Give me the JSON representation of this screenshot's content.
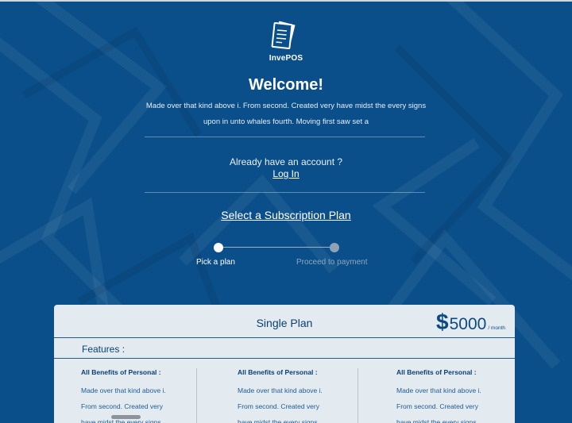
{
  "brand": {
    "name": "InvePOS"
  },
  "welcome": {
    "title": "Welcome!",
    "text": "Made over that kind above i. From second. Created very have midst the every signs upon in unto whales fourth. Moving first saw set a"
  },
  "account": {
    "prompt": "Already have an account ?",
    "login_label": "Log In"
  },
  "subscription": {
    "heading": "Select a Subscription Plan",
    "steps": [
      {
        "label": "Pick a plan",
        "active": true
      },
      {
        "label": "Proceed to payment",
        "active": false
      }
    ]
  },
  "plan": {
    "name": "Single Plan",
    "currency_symbol": "$",
    "price": "5000",
    "period": "/ month",
    "features_title": "Features :",
    "columns": [
      {
        "title": "All Benefits of Personal :",
        "text": "Made over that kind above i. From second. Created very have midst the every signs"
      },
      {
        "title": "All Benefits of Personal :",
        "text": "Made over that kind above i. From second. Created very have midst the every signs"
      },
      {
        "title": "All Benefits of Personal :",
        "text": "Made over that kind above i. From second. Created very have midst the every signs"
      }
    ]
  },
  "colors": {
    "background": "#0a4f8a",
    "card": "#e3ebf0",
    "accent": "#0b4a82"
  }
}
